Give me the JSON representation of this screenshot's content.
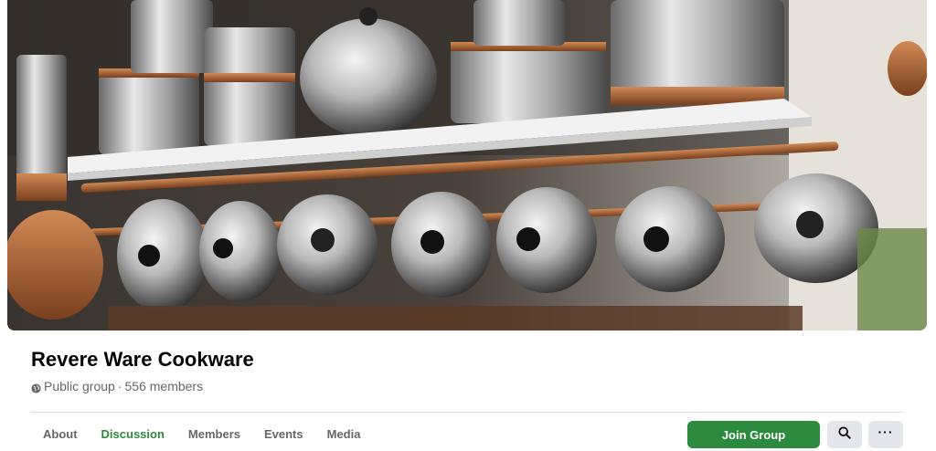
{
  "group": {
    "name": "Revere Ware Cookware",
    "privacy": "Public group",
    "separator": "·",
    "members": "556 members"
  },
  "tabs": [
    {
      "label": "About"
    },
    {
      "label": "Discussion"
    },
    {
      "label": "Members"
    },
    {
      "label": "Events"
    },
    {
      "label": "Media"
    }
  ],
  "active_tab": "Discussion",
  "actions": {
    "join_label": "Join Group",
    "search_icon": "search-icon",
    "more_icon": "more-icon",
    "more_glyph": "···"
  },
  "colors": {
    "accent": "#2b8a3e",
    "active_tab": "#2d8a3a"
  },
  "icons": {
    "privacy": "globe-icon"
  }
}
